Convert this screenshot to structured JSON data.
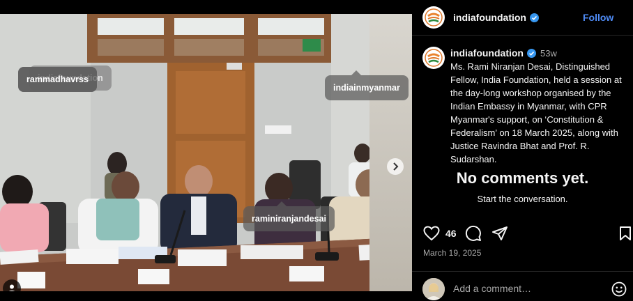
{
  "photo": {
    "tags": [
      {
        "label": "rammadhavrss",
        "ghost": false
      },
      {
        "label": "indiafoundation",
        "ghost": true
      },
      {
        "label": "indiainmyanmar",
        "ghost": false
      },
      {
        "label": "raminiranjandesai",
        "ghost": false
      }
    ],
    "carousel": {
      "slides": 4,
      "active_index": 0
    }
  },
  "post": {
    "account": "indiafoundation",
    "follow_label": "Follow",
    "more_label": "•••",
    "caption": {
      "author": "indiafoundation",
      "age": "53w",
      "text": "Ms. Rami Niranjan Desai, Distinguished Fellow, India Foundation, held a session at the day-long workshop organised by the Indian Embassy in Myanmar, with CPR Myanmar's support, on ‘Constitution & Federalism’ on 18 March 2025, along with Justice Ravindra Bhat and Prof. R. Sudarshan."
    },
    "empty_comments": {
      "title": "No comments yet.",
      "subtitle": "Start the conversation."
    },
    "likes": "46",
    "date": "March 19, 2025",
    "comment_placeholder": "Add a comment…"
  },
  "colors": {
    "accent": "#4f8cf7",
    "background": "#000000",
    "muted": "#a8a8a8",
    "divider": "#262626"
  },
  "icons": [
    "heart-icon",
    "comment-icon",
    "share-icon",
    "bookmark-icon",
    "emoji-icon",
    "chevron-right-icon",
    "user-tag-icon",
    "verified-icon"
  ]
}
